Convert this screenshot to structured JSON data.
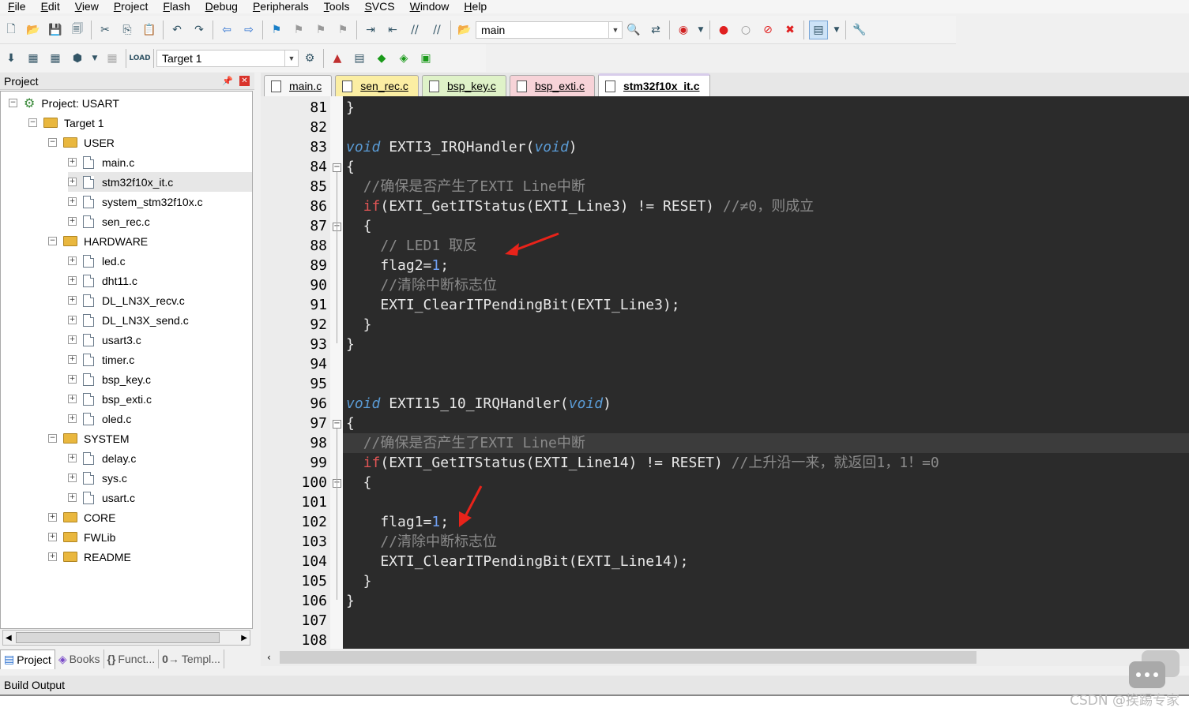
{
  "menu": [
    "File",
    "Edit",
    "View",
    "Project",
    "Flash",
    "Debug",
    "Peripherals",
    "Tools",
    "SVCS",
    "Window",
    "Help"
  ],
  "toolbar1": {
    "target_combo": "main"
  },
  "toolbar2": {
    "target_combo": "Target 1"
  },
  "project_panel": {
    "title": "Project",
    "tree": [
      {
        "label": "Project: USART",
        "level": 0,
        "type": "project",
        "expanded": true
      },
      {
        "label": "Target 1",
        "level": 1,
        "type": "target",
        "expanded": true
      },
      {
        "label": "USER",
        "level": 2,
        "type": "folder",
        "expanded": true
      },
      {
        "label": "main.c",
        "level": 3,
        "type": "file"
      },
      {
        "label": "stm32f10x_it.c",
        "level": 3,
        "type": "file",
        "selected": true
      },
      {
        "label": "system_stm32f10x.c",
        "level": 3,
        "type": "file"
      },
      {
        "label": "sen_rec.c",
        "level": 3,
        "type": "file"
      },
      {
        "label": "HARDWARE",
        "level": 2,
        "type": "folder",
        "expanded": true
      },
      {
        "label": "led.c",
        "level": 3,
        "type": "file"
      },
      {
        "label": "dht11.c",
        "level": 3,
        "type": "file"
      },
      {
        "label": "DL_LN3X_recv.c",
        "level": 3,
        "type": "file"
      },
      {
        "label": "DL_LN3X_send.c",
        "level": 3,
        "type": "file"
      },
      {
        "label": "usart3.c",
        "level": 3,
        "type": "file"
      },
      {
        "label": "timer.c",
        "level": 3,
        "type": "file"
      },
      {
        "label": "bsp_key.c",
        "level": 3,
        "type": "file"
      },
      {
        "label": "bsp_exti.c",
        "level": 3,
        "type": "file"
      },
      {
        "label": "oled.c",
        "level": 3,
        "type": "file"
      },
      {
        "label": "SYSTEM",
        "level": 2,
        "type": "folder",
        "expanded": true
      },
      {
        "label": "delay.c",
        "level": 3,
        "type": "file"
      },
      {
        "label": "sys.c",
        "level": 3,
        "type": "file"
      },
      {
        "label": "usart.c",
        "level": 3,
        "type": "file"
      },
      {
        "label": "CORE",
        "level": 2,
        "type": "folder",
        "expanded": false
      },
      {
        "label": "FWLib",
        "level": 2,
        "type": "folder",
        "expanded": false
      },
      {
        "label": "README",
        "level": 2,
        "type": "folder",
        "expanded": false
      }
    ],
    "tabs": [
      "Project",
      "Books",
      "Funct...",
      "Templ..."
    ],
    "tab_icons": [
      "",
      "",
      "{}",
      "0→"
    ]
  },
  "editor_tabs": [
    {
      "label": "main.c",
      "color": "#f7f7f7"
    },
    {
      "label": "sen_rec.c",
      "color": "#fbeea3"
    },
    {
      "label": "bsp_key.c",
      "color": "#dff2c8"
    },
    {
      "label": "bsp_exti.c",
      "color": "#f7d3d8"
    },
    {
      "label": "stm32f10x_it.c",
      "color": "#d8cdeb",
      "active": true
    }
  ],
  "code": [
    {
      "n": "81",
      "t": "}"
    },
    {
      "n": "82",
      "t": ""
    },
    {
      "n": "83",
      "t": "void EXTI3_IRQHandler(void)"
    },
    {
      "n": "84",
      "t": "{"
    },
    {
      "n": "85",
      "t": "  //确保是否产生了EXTI Line中断"
    },
    {
      "n": "86",
      "t": "  if(EXTI_GetITStatus(EXTI_Line3) != RESET) //≠0，则成立"
    },
    {
      "n": "87",
      "t": "  {"
    },
    {
      "n": "88",
      "t": "    // LED1 取反"
    },
    {
      "n": "89",
      "t": "    flag2=1;"
    },
    {
      "n": "90",
      "t": "    //清除中断标志位"
    },
    {
      "n": "91",
      "t": "    EXTI_ClearITPendingBit(EXTI_Line3);"
    },
    {
      "n": "92",
      "t": "  }"
    },
    {
      "n": "93",
      "t": "}"
    },
    {
      "n": "94",
      "t": ""
    },
    {
      "n": "95",
      "t": ""
    },
    {
      "n": "96",
      "t": "void EXTI15_10_IRQHandler(void)"
    },
    {
      "n": "97",
      "t": "{"
    },
    {
      "n": "98",
      "t": "  //确保是否产生了EXTI Line中断"
    },
    {
      "n": "99",
      "t": "  if(EXTI_GetITStatus(EXTI_Line14) != RESET) //上升沿一来，就返回1，1！=0"
    },
    {
      "n": "100",
      "t": "  {"
    },
    {
      "n": "101",
      "t": ""
    },
    {
      "n": "102",
      "t": "    flag1=1;"
    },
    {
      "n": "103",
      "t": "    //清除中断标志位"
    },
    {
      "n": "104",
      "t": "    EXTI_ClearITPendingBit(EXTI_Line14);"
    },
    {
      "n": "105",
      "t": "  }"
    },
    {
      "n": "106",
      "t": "}"
    },
    {
      "n": "107",
      "t": ""
    },
    {
      "n": "108",
      "t": ""
    }
  ],
  "build_output": {
    "title": "Build Output"
  },
  "watermark": "CSDN @挨踢专家"
}
